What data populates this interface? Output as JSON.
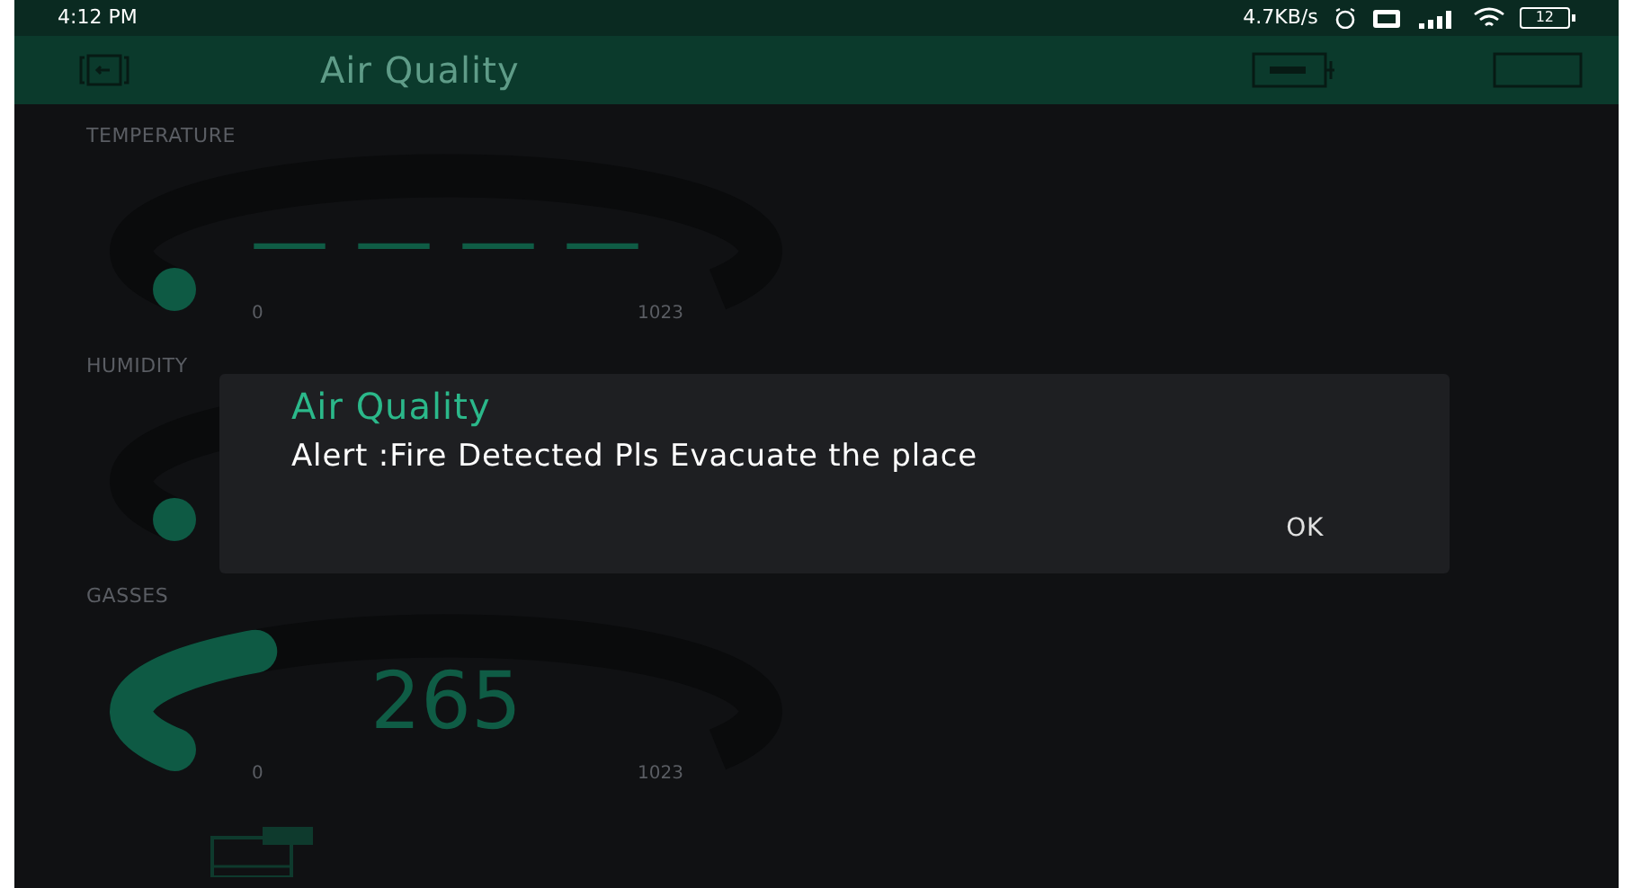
{
  "status_bar": {
    "time": "4:12 PM",
    "speed": "4.7KB/s",
    "battery": "12"
  },
  "app_bar": {
    "title": "Air Quality"
  },
  "gauges": [
    {
      "label": "TEMPERATURE",
      "value": "— — — —",
      "min": "0",
      "max": "1023"
    },
    {
      "label": "HUMIDITY"
    },
    {
      "label": "GASSES",
      "value": "265",
      "min": "0",
      "max": "1023"
    }
  ],
  "dialog": {
    "title": "Air Quality",
    "message": "Alert :Fire Detected Pls Evacuate the place",
    "button": "OK"
  }
}
